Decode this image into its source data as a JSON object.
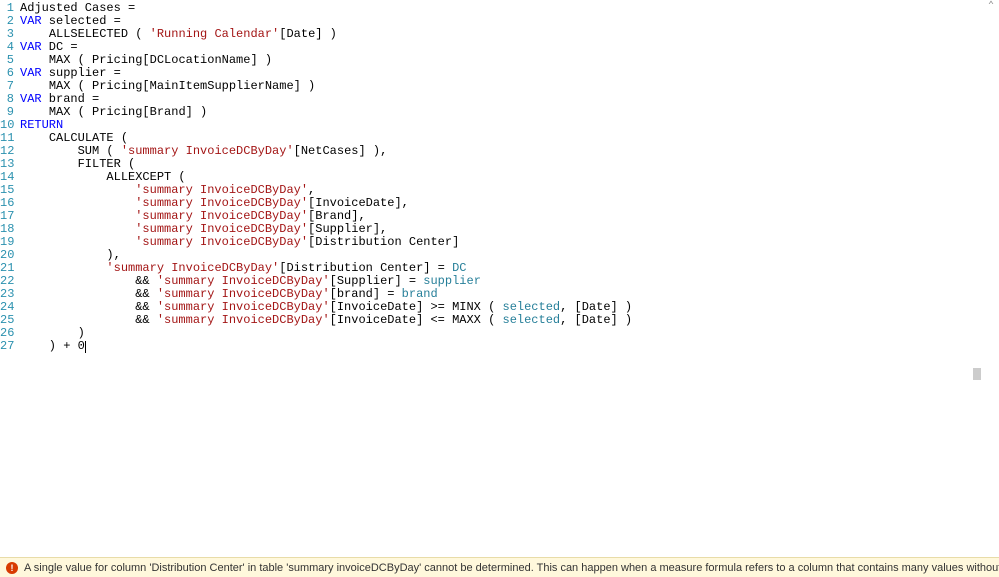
{
  "code": {
    "lines": [
      {
        "n": 1,
        "tokens": [
          {
            "t": "Adjusted Cases ",
            "c": ""
          },
          {
            "t": "=",
            "c": ""
          }
        ]
      },
      {
        "n": 2,
        "tokens": [
          {
            "t": "VAR",
            "c": "kw-var"
          },
          {
            "t": " selected ",
            "c": ""
          },
          {
            "t": "=",
            "c": ""
          }
        ]
      },
      {
        "n": 3,
        "tokens": [
          {
            "t": "    ",
            "c": ""
          },
          {
            "t": "ALLSELECTED",
            "c": "kw-func"
          },
          {
            "t": " ( ",
            "c": ""
          },
          {
            "t": "'Running Calendar'",
            "c": "kw-tbl"
          },
          {
            "t": "[Date] )",
            "c": ""
          }
        ]
      },
      {
        "n": 4,
        "tokens": [
          {
            "t": "VAR",
            "c": "kw-var"
          },
          {
            "t": " DC ",
            "c": ""
          },
          {
            "t": "=",
            "c": ""
          }
        ]
      },
      {
        "n": 5,
        "tokens": [
          {
            "t": "    ",
            "c": ""
          },
          {
            "t": "MAX",
            "c": "kw-func"
          },
          {
            "t": " ( Pricing[DCLocationName] )",
            "c": ""
          }
        ]
      },
      {
        "n": 6,
        "tokens": [
          {
            "t": "VAR",
            "c": "kw-var"
          },
          {
            "t": " supplier ",
            "c": ""
          },
          {
            "t": "=",
            "c": ""
          }
        ]
      },
      {
        "n": 7,
        "tokens": [
          {
            "t": "    ",
            "c": ""
          },
          {
            "t": "MAX",
            "c": "kw-func"
          },
          {
            "t": " ( Pricing[MainItemSupplierName] )",
            "c": ""
          }
        ]
      },
      {
        "n": 8,
        "tokens": [
          {
            "t": "VAR",
            "c": "kw-var"
          },
          {
            "t": " brand ",
            "c": ""
          },
          {
            "t": "=",
            "c": ""
          }
        ]
      },
      {
        "n": 9,
        "tokens": [
          {
            "t": "    ",
            "c": ""
          },
          {
            "t": "MAX",
            "c": "kw-func"
          },
          {
            "t": " ( Pricing[Brand] )",
            "c": ""
          }
        ]
      },
      {
        "n": 10,
        "tokens": [
          {
            "t": "RETURN",
            "c": "kw-return"
          }
        ]
      },
      {
        "n": 11,
        "tokens": [
          {
            "t": "    ",
            "c": ""
          },
          {
            "t": "CALCULATE",
            "c": "kw-func"
          },
          {
            "t": " (",
            "c": ""
          }
        ]
      },
      {
        "n": 12,
        "tokens": [
          {
            "t": "        ",
            "c": ""
          },
          {
            "t": "SUM",
            "c": "kw-func"
          },
          {
            "t": " ( ",
            "c": ""
          },
          {
            "t": "'summary InvoiceDCByDay'",
            "c": "kw-tbl"
          },
          {
            "t": "[NetCases] ),",
            "c": ""
          }
        ]
      },
      {
        "n": 13,
        "tokens": [
          {
            "t": "        ",
            "c": ""
          },
          {
            "t": "FILTER",
            "c": "kw-func"
          },
          {
            "t": " (",
            "c": ""
          }
        ]
      },
      {
        "n": 14,
        "tokens": [
          {
            "t": "            ",
            "c": ""
          },
          {
            "t": "ALLEXCEPT",
            "c": "kw-func"
          },
          {
            "t": " (",
            "c": ""
          }
        ]
      },
      {
        "n": 15,
        "tokens": [
          {
            "t": "                ",
            "c": ""
          },
          {
            "t": "'summary InvoiceDCByDay'",
            "c": "kw-tbl"
          },
          {
            "t": ",",
            "c": ""
          }
        ]
      },
      {
        "n": 16,
        "tokens": [
          {
            "t": "                ",
            "c": ""
          },
          {
            "t": "'summary InvoiceDCByDay'",
            "c": "kw-tbl"
          },
          {
            "t": "[InvoiceDate],",
            "c": ""
          }
        ]
      },
      {
        "n": 17,
        "tokens": [
          {
            "t": "                ",
            "c": ""
          },
          {
            "t": "'summary InvoiceDCByDay'",
            "c": "kw-tbl"
          },
          {
            "t": "[Brand],",
            "c": ""
          }
        ]
      },
      {
        "n": 18,
        "tokens": [
          {
            "t": "                ",
            "c": ""
          },
          {
            "t": "'summary InvoiceDCByDay'",
            "c": "kw-tbl"
          },
          {
            "t": "[Supplier],",
            "c": ""
          }
        ]
      },
      {
        "n": 19,
        "tokens": [
          {
            "t": "                ",
            "c": ""
          },
          {
            "t": "'summary InvoiceDCByDay'",
            "c": "kw-tbl"
          },
          {
            "t": "[Distribution Center]",
            "c": ""
          }
        ]
      },
      {
        "n": 20,
        "tokens": [
          {
            "t": "            ),",
            "c": ""
          }
        ]
      },
      {
        "n": 21,
        "tokens": [
          {
            "t": "            ",
            "c": ""
          },
          {
            "t": "'summary InvoiceDCByDay'",
            "c": "kw-tbl"
          },
          {
            "t": "[Distribution Center] = ",
            "c": ""
          },
          {
            "t": "DC",
            "c": "kw-used"
          }
        ]
      },
      {
        "n": 22,
        "tokens": [
          {
            "t": "                && ",
            "c": ""
          },
          {
            "t": "'summary InvoiceDCByDay'",
            "c": "kw-tbl"
          },
          {
            "t": "[Supplier] = ",
            "c": ""
          },
          {
            "t": "supplier",
            "c": "kw-used"
          }
        ]
      },
      {
        "n": 23,
        "tokens": [
          {
            "t": "                && ",
            "c": ""
          },
          {
            "t": "'summary InvoiceDCByDay'",
            "c": "kw-tbl"
          },
          {
            "t": "[brand] = ",
            "c": ""
          },
          {
            "t": "brand",
            "c": "kw-used"
          }
        ]
      },
      {
        "n": 24,
        "tokens": [
          {
            "t": "                && ",
            "c": ""
          },
          {
            "t": "'summary InvoiceDCByDay'",
            "c": "kw-tbl"
          },
          {
            "t": "[InvoiceDate] >= ",
            "c": ""
          },
          {
            "t": "MINX",
            "c": "kw-func"
          },
          {
            "t": " ( ",
            "c": ""
          },
          {
            "t": "selected",
            "c": "kw-used"
          },
          {
            "t": ", [Date] )",
            "c": ""
          }
        ]
      },
      {
        "n": 25,
        "tokens": [
          {
            "t": "                && ",
            "c": ""
          },
          {
            "t": "'summary InvoiceDCByDay'",
            "c": "kw-tbl"
          },
          {
            "t": "[InvoiceDate] <= ",
            "c": ""
          },
          {
            "t": "MAXX",
            "c": "kw-func"
          },
          {
            "t": " ( ",
            "c": ""
          },
          {
            "t": "selected",
            "c": "kw-used"
          },
          {
            "t": ", [Date] )",
            "c": ""
          }
        ]
      },
      {
        "n": 26,
        "tokens": [
          {
            "t": "        )",
            "c": ""
          }
        ]
      },
      {
        "n": 27,
        "tokens": [
          {
            "t": "    ) + 0",
            "c": ""
          }
        ],
        "cursor": true
      }
    ]
  },
  "error": {
    "message": "A single value for column 'Distribution Center' in table 'summary invoiceDCByDay' cannot be determined. This can happen when a measure formula refers to a column that contains many values without specifying an aggregation such as min, max, count, or sum to get a single resu"
  },
  "scroll_indicator": "⌃"
}
